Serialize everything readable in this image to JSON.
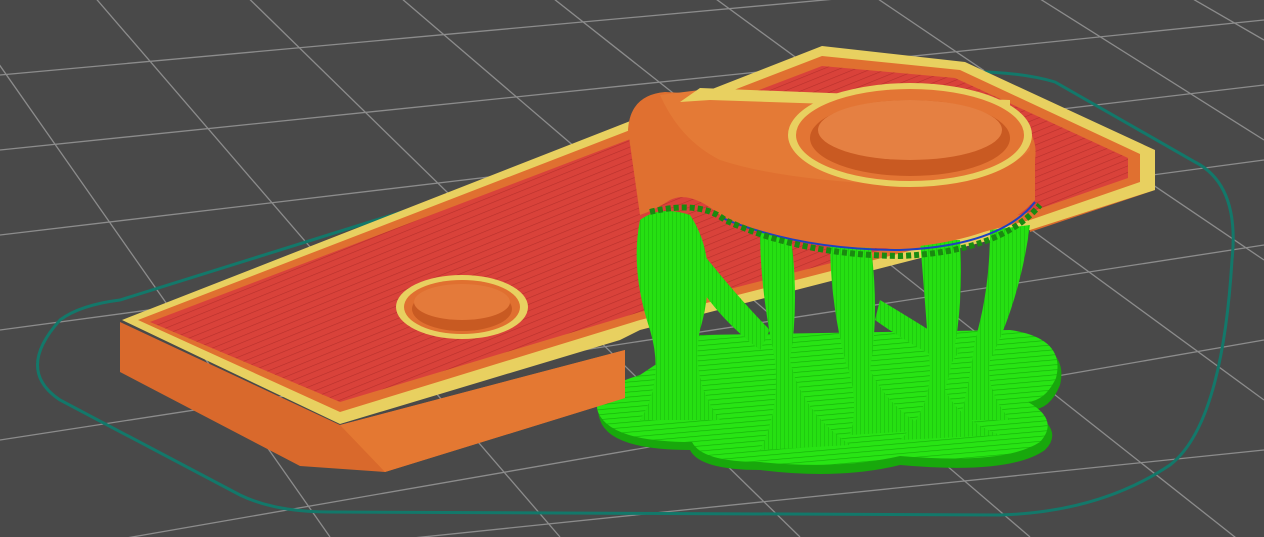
{
  "viewport": {
    "view": "sliced-preview",
    "colors": {
      "background": "#494949",
      "grid": "#8a8a8a",
      "skirt": "#13786a",
      "perimeter_outer": "#e0702e",
      "perimeter_inner": "#e8d060",
      "top_solid_infill": "#d8403a",
      "support": "#22dd10",
      "support_interface": "#1a9a10",
      "wipe": "#2040c0"
    }
  }
}
